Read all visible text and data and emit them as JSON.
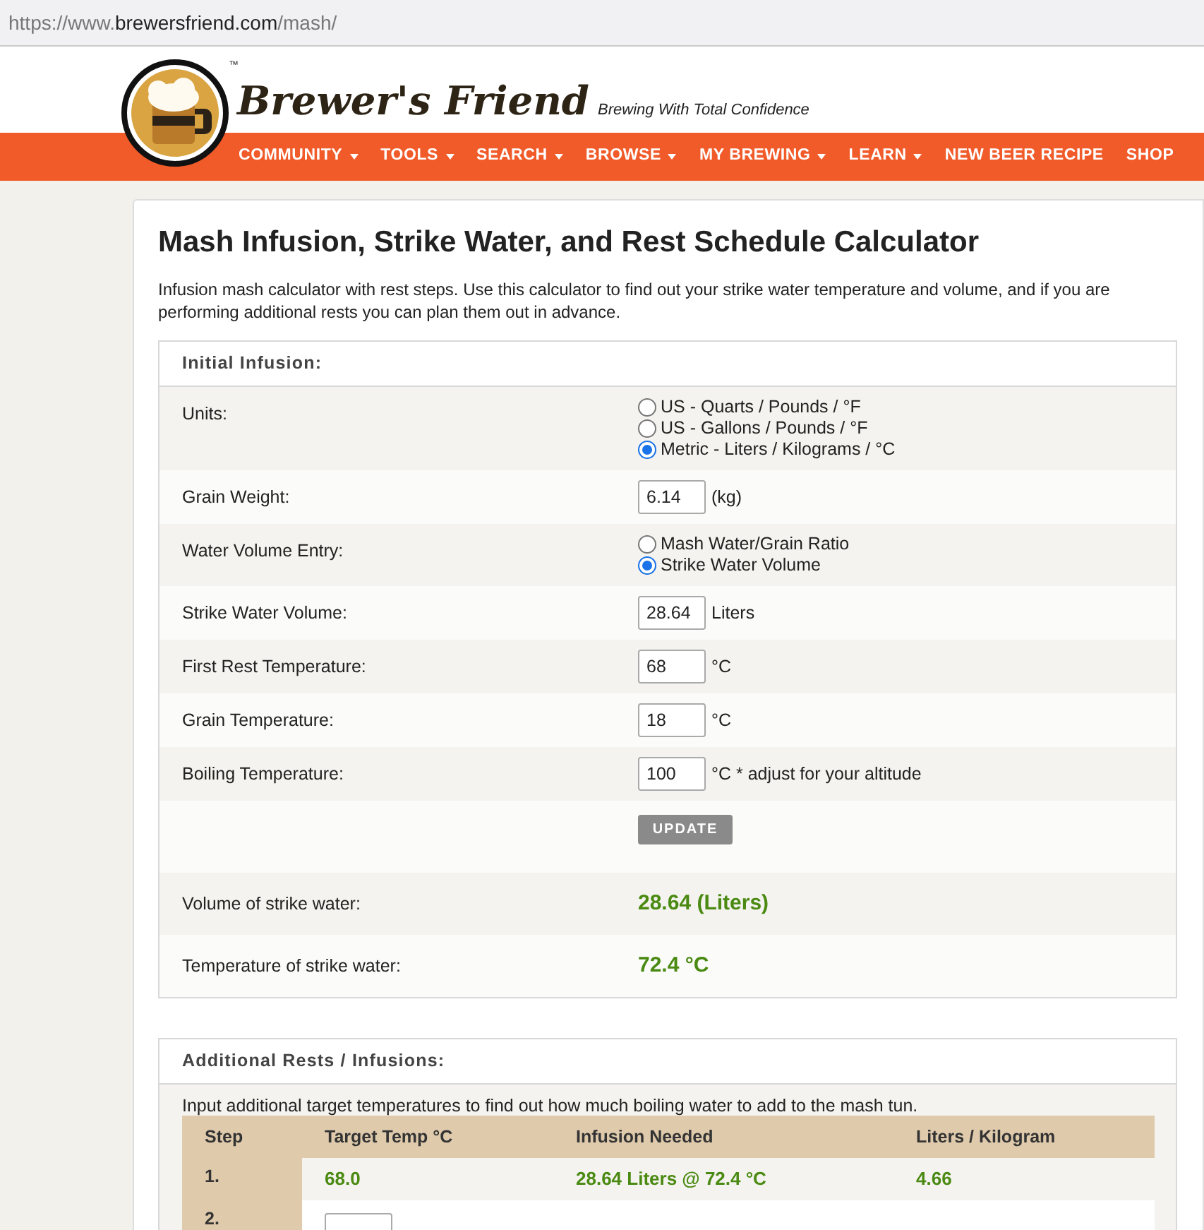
{
  "url": {
    "prefix": "https://www.",
    "host": "brewersfriend.com",
    "path": "/mash/"
  },
  "brand": {
    "name": "Brewer's Friend",
    "tagline": "Brewing With Total Confidence",
    "trademark": "™"
  },
  "nav": [
    {
      "label": "COMMUNITY",
      "dropdown": true
    },
    {
      "label": "TOOLS",
      "dropdown": true
    },
    {
      "label": "SEARCH",
      "dropdown": true
    },
    {
      "label": "BROWSE",
      "dropdown": true
    },
    {
      "label": "MY BREWING",
      "dropdown": true
    },
    {
      "label": "LEARN",
      "dropdown": true
    },
    {
      "label": "NEW BEER RECIPE",
      "dropdown": false
    },
    {
      "label": "SHOP",
      "dropdown": false
    }
  ],
  "title": "Mash Infusion, Strike Water, and Rest Schedule Calculator",
  "description": "Infusion mash calculator with rest steps. Use this calculator to find out your strike water temperature and volume, and if you are performing additional rests you can plan them out in advance.",
  "initial_infusion": {
    "title": "Initial Infusion:",
    "rows": [
      {
        "kind": "radio",
        "label": "Units:",
        "options": [
          {
            "label": "US - Quarts / Pounds / °F",
            "selected": false
          },
          {
            "label": "US - Gallons / Pounds / °F",
            "selected": false
          },
          {
            "label": "Metric - Liters / Kilograms / °C",
            "selected": true
          }
        ]
      },
      {
        "kind": "input",
        "label": "Grain Weight:",
        "value": "6.14",
        "unit": "(kg)"
      },
      {
        "kind": "radio",
        "label": "Water Volume Entry:",
        "options": [
          {
            "label": "Mash Water/Grain Ratio",
            "selected": false
          },
          {
            "label": "Strike Water Volume",
            "selected": true
          }
        ]
      },
      {
        "kind": "input",
        "label": "Strike Water Volume:",
        "value": "28.64",
        "unit": "Liters"
      },
      {
        "kind": "input",
        "label": "First Rest Temperature:",
        "value": "68",
        "unit": "°C"
      },
      {
        "kind": "input",
        "label": "Grain Temperature:",
        "value": "18",
        "unit": "°C"
      },
      {
        "kind": "input",
        "label": "Boiling Temperature:",
        "value": "100",
        "unit": "°C * adjust for your altitude"
      },
      {
        "kind": "button",
        "label": "UPDATE"
      },
      {
        "kind": "result",
        "label": "Volume of strike water:",
        "value": "28.64 (Liters)"
      },
      {
        "kind": "result",
        "label": "Temperature of strike water:",
        "value": "72.4 °C"
      }
    ]
  },
  "additional": {
    "title": "Additional Rests / Infusions:",
    "note": "Input additional target temperatures to find out how much boiling water to add to the mash tun.",
    "columns": [
      "Step",
      "Target Temp °C",
      "Infusion Needed",
      "Liters / Kilogram"
    ],
    "rows": [
      {
        "kind": "result",
        "step": "1.",
        "target": "68.0",
        "infusion": "28.64 Liters @ 72.4 °C",
        "ratio": "4.66"
      },
      {
        "kind": "input",
        "step": "2."
      }
    ]
  }
}
